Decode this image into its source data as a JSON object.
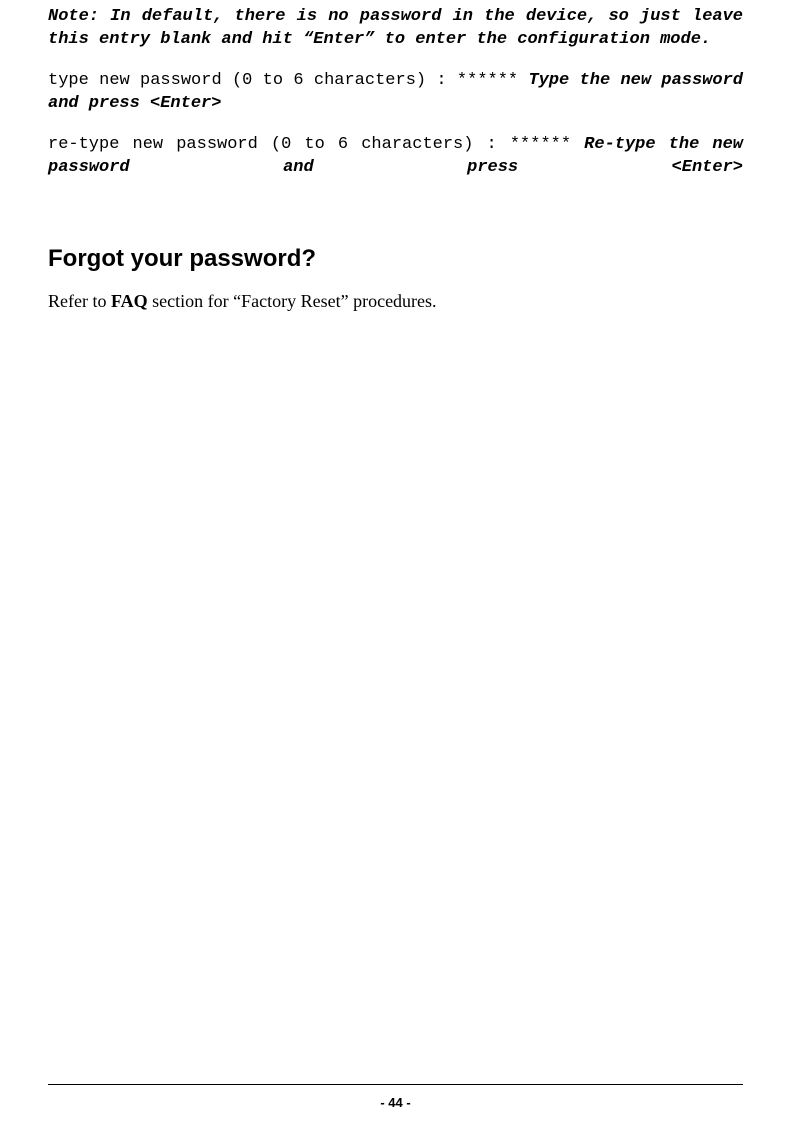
{
  "note": {
    "text": "Note: In default, there is no password in the device, so just leave this entry blank and hit “Enter” to enter the configuration mode."
  },
  "type_password": {
    "prompt": "type new password (0 to 6 characters) : ****** ",
    "instruction": "Type the new password and press <Enter>"
  },
  "retype_password": {
    "prompt": "re-type new password (0 to 6 characters) : ****** ",
    "instruction": "Re-type the new password and press <Enter>"
  },
  "heading": "Forgot your password?",
  "faq_para": {
    "prefix": "Refer to ",
    "bold": "FAQ",
    "suffix": " section for “Factory Reset” procedures."
  },
  "page_number": "- 44 -"
}
